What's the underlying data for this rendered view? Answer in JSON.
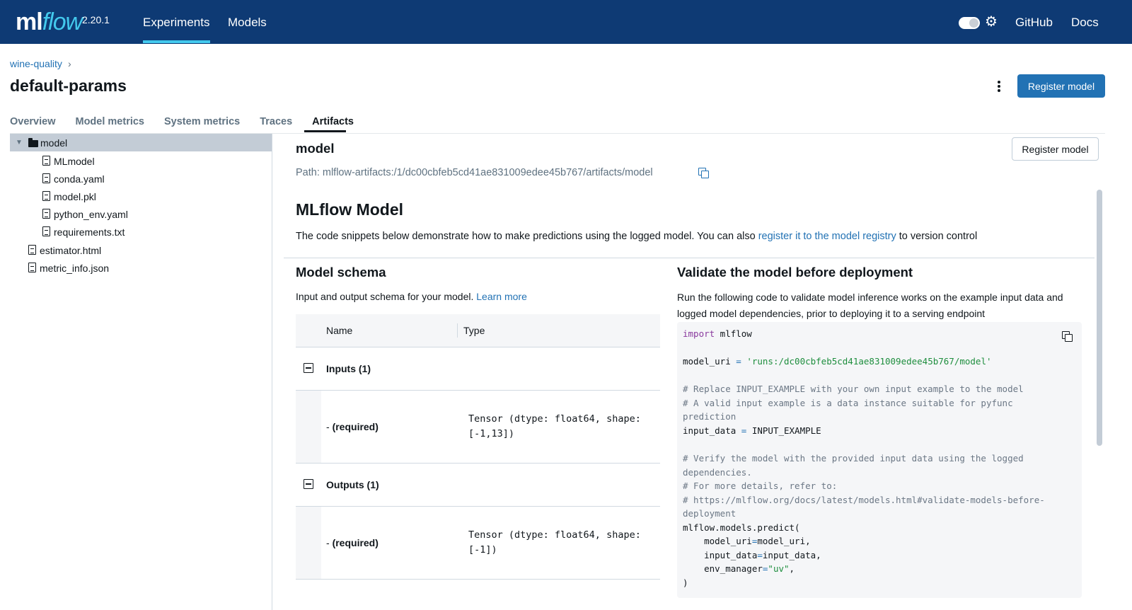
{
  "topnav": {
    "logo_ml": "ml",
    "logo_flow": "flow",
    "version": "2.20.1",
    "links": [
      "Experiments",
      "Models"
    ],
    "active_link": "Experiments",
    "gear_glyph": "⚙",
    "github": "GitHub",
    "docs": "Docs",
    "accent": "#43c9ed",
    "bg": "#0e3a74"
  },
  "header": {
    "breadcrumb": "wine-quality",
    "breadcrumb_sep": "›",
    "title": "default-params",
    "register_button": "Register model"
  },
  "tabs": [
    "Overview",
    "Model metrics",
    "System metrics",
    "Traces",
    "Artifacts"
  ],
  "active_tab": "Artifacts",
  "tree": {
    "caret": "▼",
    "folder": "model",
    "children": [
      "MLmodel",
      "conda.yaml",
      "model.pkl",
      "python_env.yaml",
      "requirements.txt"
    ],
    "root_files": [
      "estimator.html",
      "metric_info.json"
    ]
  },
  "artifact": {
    "name": "model",
    "path": "Path: mlflow-artifacts:/1/dc00cbfeb5cd41ae831009edee45b767/artifacts/model",
    "register_button": "Register model",
    "heading": "MLflow Model",
    "desc_before": "The code snippets below demonstrate how to make predictions using the logged model. You can also ",
    "desc_link": "register it to the model registry",
    "desc_after": " to version control"
  },
  "schema": {
    "heading": "Model schema",
    "subtitle": "Input and output schema for your model. ",
    "learn_more": "Learn more",
    "col_name": "Name",
    "col_type": "Type",
    "groups": [
      {
        "label": "Inputs (1)",
        "field_prefix": "- ",
        "field_name": "(required)",
        "field_type": "Tensor (dtype: float64, shape: [-1,13])"
      },
      {
        "label": "Outputs (1)",
        "field_prefix": "- ",
        "field_name": "(required)",
        "field_type": "Tensor (dtype: float64, shape: [-1])"
      }
    ]
  },
  "validate": {
    "heading": "Validate the model before deployment",
    "description": "Run the following code to validate model inference works on the example input data and logged model dependencies, prior to deploying it to a serving endpoint",
    "code": {
      "l1_kw": "import",
      "l1_rest": " mlflow",
      "l2_var": "model_uri ",
      "l2_eq": "=",
      "l2_str": " 'runs:/dc00cbfeb5cd41ae831009edee45b767/model'",
      "l3": "# Replace INPUT_EXAMPLE with your own input example to the model",
      "l4": "# A valid input example is a data instance suitable for pyfunc",
      "l5": "prediction",
      "l6_var": "input_data ",
      "l6_eq": "=",
      "l6_rest": " INPUT_EXAMPLE",
      "l7": "# Verify the model with the provided input data using the logged",
      "l8": "dependencies.",
      "l9": "# For more details, refer to:",
      "l10": "# https://mlflow.org/docs/latest/models.html#validate-models-before-",
      "l11": "deployment",
      "l12": "mlflow.models.predict(",
      "l13_a": "    model_uri",
      "l13_eq": "=",
      "l13_b": "model_uri,",
      "l14_a": "    input_data",
      "l14_eq": "=",
      "l14_b": "input_data,",
      "l15_a": "    env_manager",
      "l15_eq": "=",
      "l15_str": "\"uv\"",
      "l15_c": ",",
      "l16": ")"
    }
  }
}
